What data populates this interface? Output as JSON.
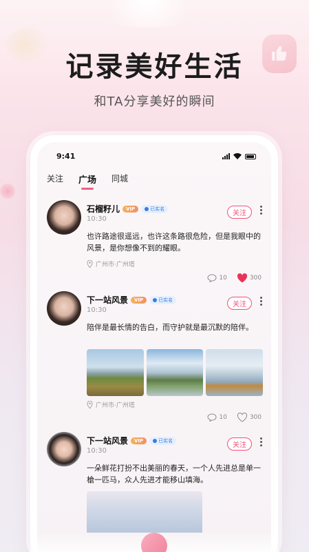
{
  "promo": {
    "headline": "记录美好生活",
    "subline": "和TA分享美好的瞬间"
  },
  "status_bar": {
    "time": "9:41"
  },
  "tabs": [
    {
      "label": "关注",
      "active": false
    },
    {
      "label": "广场",
      "active": true
    },
    {
      "label": "同城",
      "active": false
    }
  ],
  "posts": [
    {
      "name": "石榴籽儿",
      "vip": "VIP",
      "verified": "已实名",
      "time": "10:30",
      "follow_label": "关注",
      "text": "也许路途很遥远，也许这条路很危险，但是我眼中的风景，是你想像不到的耀眼。",
      "location": "广州市·广州塔",
      "comments": "10",
      "likes": "300",
      "liked": true
    },
    {
      "name": "下一站风景",
      "vip": "VIP",
      "verified": "已实名",
      "time": "10:30",
      "follow_label": "关注",
      "text": "陪伴是最长情的告白，而守护就是最沉默的陪伴。",
      "location": "广州市·广州塔",
      "comments": "10",
      "likes": "300",
      "liked": false
    },
    {
      "name": "下一站风景",
      "vip": "VIP",
      "verified": "已实名",
      "time": "10:30",
      "follow_label": "关注",
      "text": "一朵鲜花打扮不出美丽的春天，一个人先进总是单一槍一匹马，众人先进才能移山填海。"
    }
  ],
  "colors": {
    "accent": "#f0507a",
    "heart": "#e8345a"
  }
}
